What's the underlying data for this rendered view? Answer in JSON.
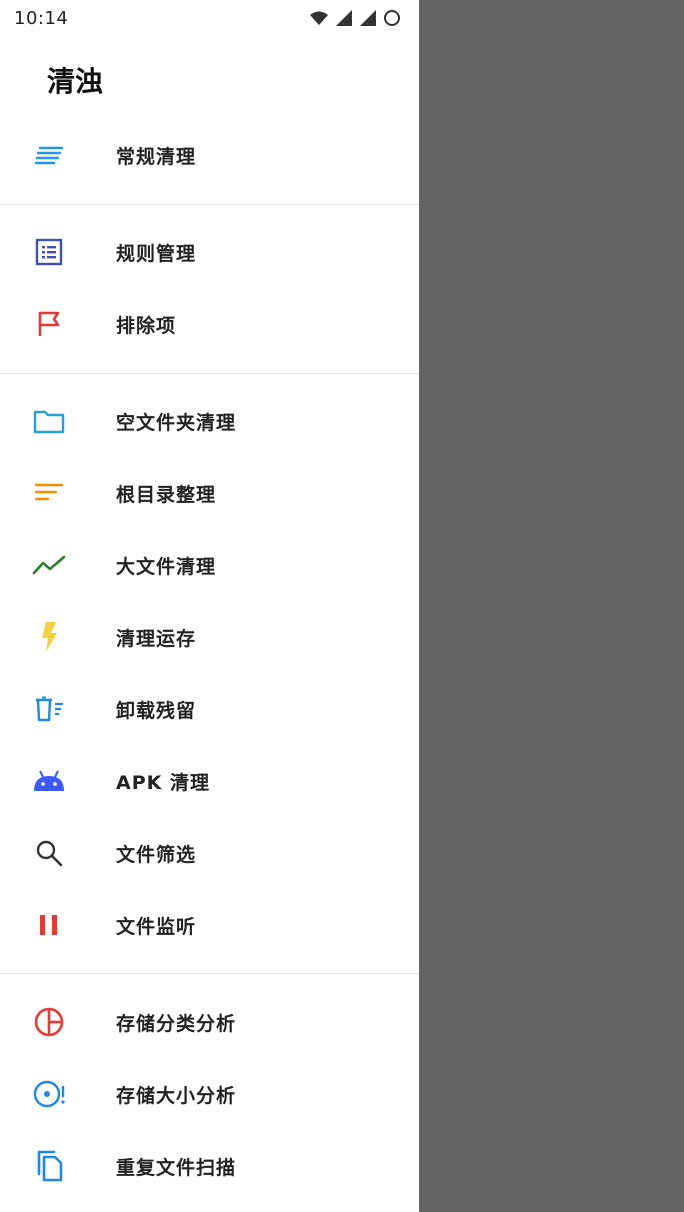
{
  "status_bar": {
    "time": "10:14"
  },
  "drawer": {
    "title": "清浊",
    "groups": [
      {
        "items": [
          {
            "label": "常规清理",
            "icon": "lines-icon",
            "color": "#2196F3"
          }
        ]
      },
      {
        "items": [
          {
            "label": "规则管理",
            "icon": "list-icon",
            "color": "#3F51B5"
          },
          {
            "label": "排除项",
            "icon": "flag-icon",
            "color": "#E53935"
          }
        ]
      },
      {
        "items": [
          {
            "label": "空文件夹清理",
            "icon": "folder-icon",
            "color": "#26A0DA"
          },
          {
            "label": "根目录整理",
            "icon": "sort-icon",
            "color": "#FB8C00"
          },
          {
            "label": "大文件清理",
            "icon": "trend-icon",
            "color": "#2E7D32"
          },
          {
            "label": "清理运存",
            "icon": "bolt-icon",
            "color": "#F4D03F"
          },
          {
            "label": "卸载残留",
            "icon": "trash-lines-icon",
            "color": "#1E88E5"
          },
          {
            "label": "APK 清理",
            "icon": "android-icon",
            "color": "#3D5AFE"
          },
          {
            "label": "文件筛选",
            "icon": "search-icon",
            "color": "#333333"
          },
          {
            "label": "文件监听",
            "icon": "pause-icon",
            "color": "#E53935"
          }
        ]
      },
      {
        "items": [
          {
            "label": "存储分类分析",
            "icon": "pie-icon",
            "color": "#E53935"
          },
          {
            "label": "存储大小分析",
            "icon": "dial-icon",
            "color": "#1E88E5"
          },
          {
            "label": "重复文件扫描",
            "icon": "copy-icon",
            "color": "#1E88E5"
          }
        ]
      }
    ]
  }
}
